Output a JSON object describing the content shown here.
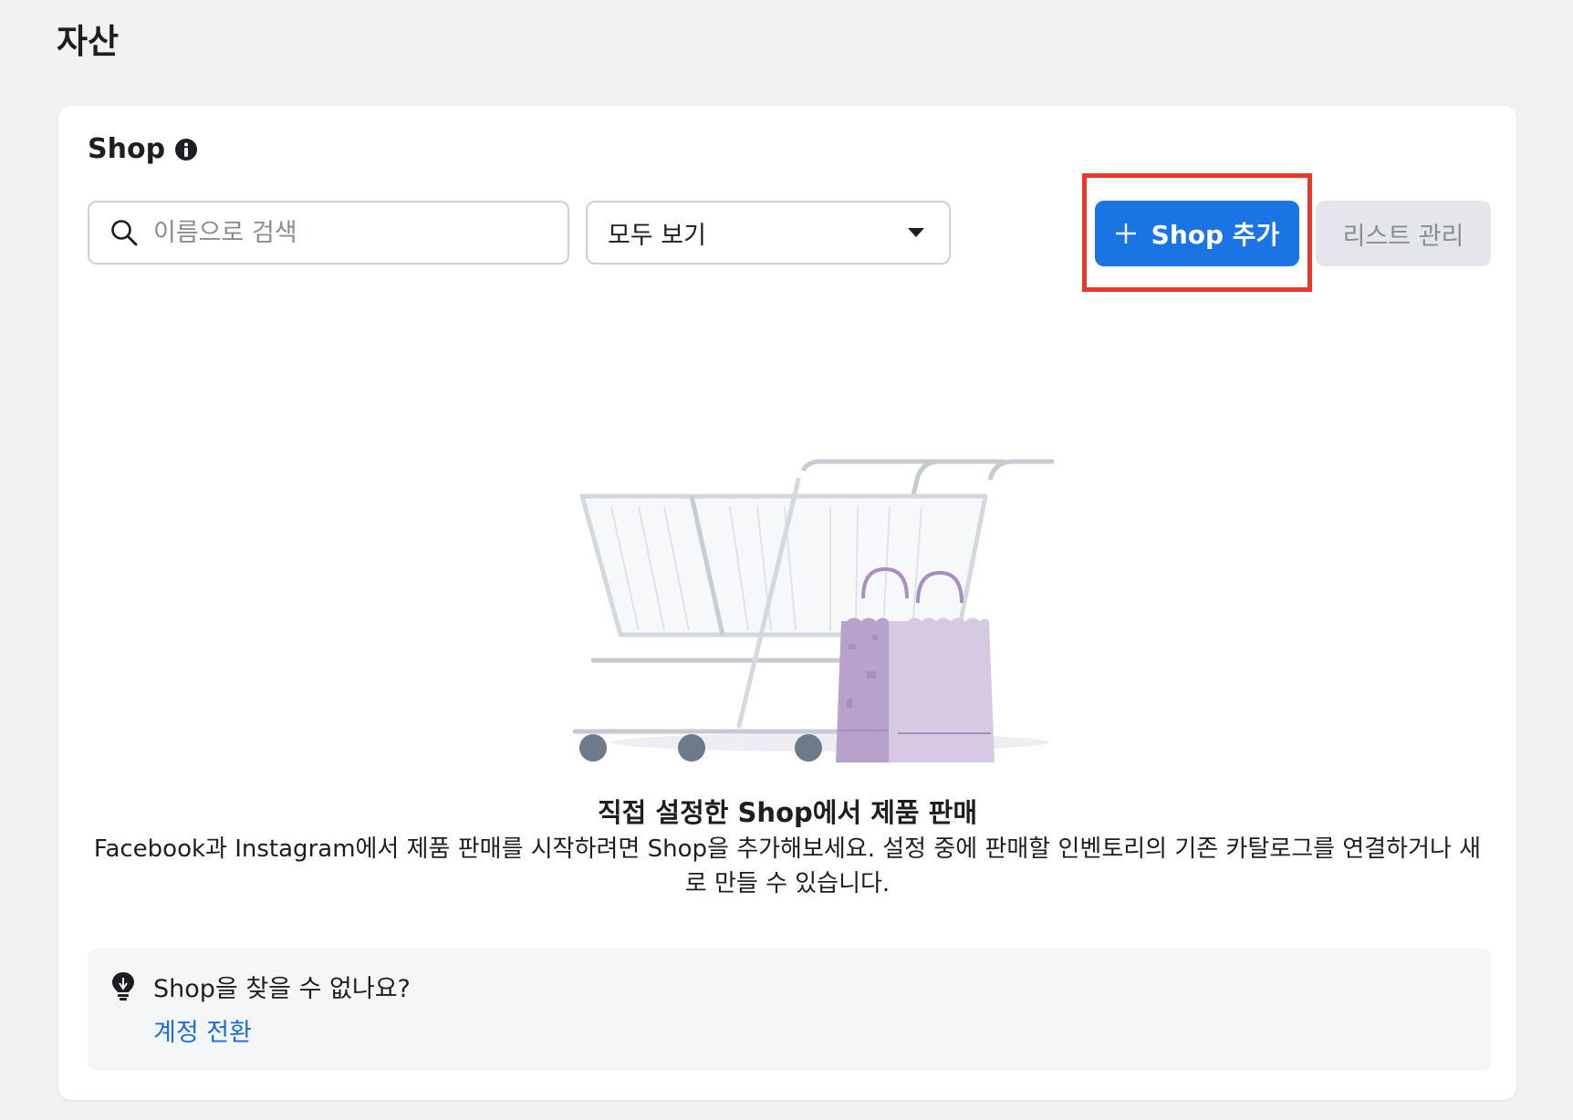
{
  "page": {
    "title": "자산"
  },
  "shop_card": {
    "title": "Shop",
    "info_icon": "info-icon",
    "search": {
      "placeholder": "이름으로 검색",
      "value": ""
    },
    "filter": {
      "selected": "모두 보기"
    },
    "buttons": {
      "add_shop_label": "Shop 추가",
      "manage_list_label": "리스트 관리"
    },
    "empty_state": {
      "title": "직접 설정한 Shop에서 제품 판매",
      "description": "Facebook과 Instagram에서 제품 판매를 시작하려면 Shop을 추가해보세요. 설정 중에 판매할 인벤토리의 기존 카탈로그를 연결하거나 새로 만들 수 있습니다."
    },
    "tip": {
      "title": "Shop을 찾을 수 없나요?",
      "link": "계정 전환"
    }
  },
  "colors": {
    "primary": "#1b74e4",
    "highlight": "#e8392a",
    "link": "#1b6ed8",
    "bag": "#c9b6d6"
  }
}
